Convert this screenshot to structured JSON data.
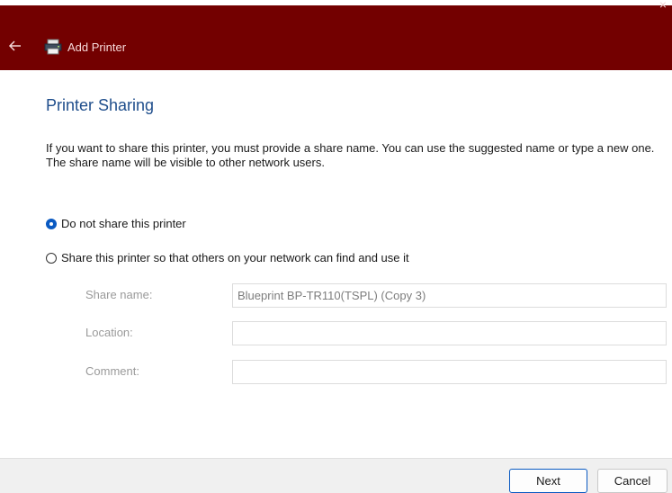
{
  "window": {
    "title": "Add Printer",
    "close_glyph": "×",
    "back_icon": "arrow-left-icon",
    "app_icon": "printer-icon"
  },
  "page": {
    "heading": "Printer Sharing",
    "description": "If you want to share this printer, you must provide a share name. You can use the suggested name or type a new one. The share name will be visible to other network users."
  },
  "options": [
    {
      "label": "Do not share this printer",
      "selected": true
    },
    {
      "label": "Share this printer so that others on your network can find and use it",
      "selected": false
    }
  ],
  "fields": {
    "share_name": {
      "label": "Share name:",
      "value": "Blueprint BP-TR110(TSPL) (Copy 3)"
    },
    "location": {
      "label": "Location:",
      "value": ""
    },
    "comment": {
      "label": "Comment:",
      "value": ""
    }
  },
  "buttons": {
    "next": "Next",
    "cancel": "Cancel"
  },
  "colors": {
    "titlebar": "#730000",
    "heading": "#1f4e8c",
    "accent": "#0a5ac2"
  }
}
